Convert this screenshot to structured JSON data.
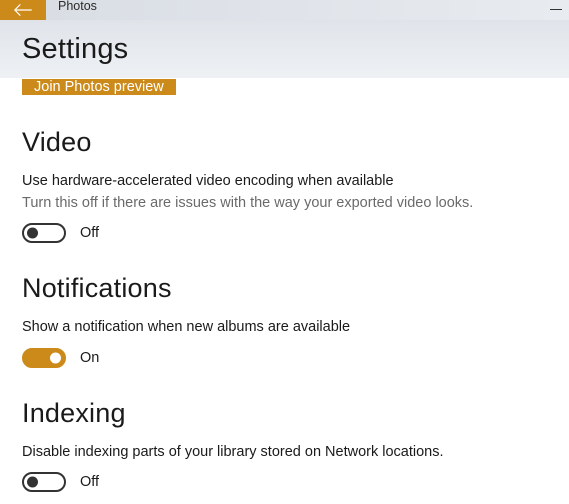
{
  "titlebar": {
    "app_name": "Photos"
  },
  "page": {
    "heading": "Settings"
  },
  "preview": {
    "button_label": "Join Photos preview"
  },
  "sections": {
    "video": {
      "heading": "Video",
      "title": "Use hardware-accelerated video encoding when available",
      "subtitle": "Turn this off if there are issues with the way your exported video looks.",
      "state_label": "Off",
      "on": false
    },
    "notifications": {
      "heading": "Notifications",
      "title": "Show a notification when new albums are available",
      "state_label": "On",
      "on": true
    },
    "indexing": {
      "heading": "Indexing",
      "title": "Disable indexing parts of your library stored on Network locations.",
      "state_label": "Off",
      "on": false
    }
  },
  "colors": {
    "accent": "#cc8a1a"
  }
}
